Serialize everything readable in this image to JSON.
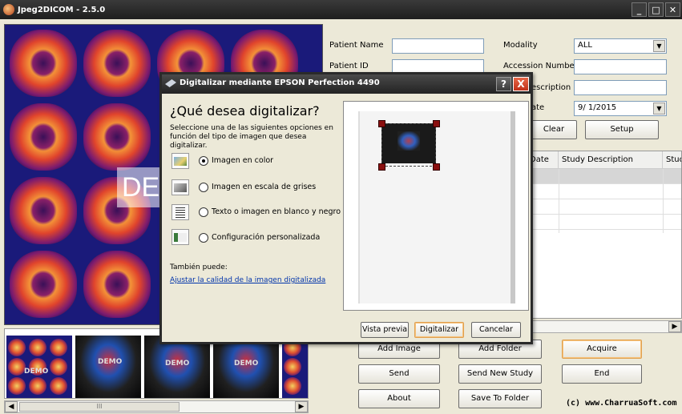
{
  "window": {
    "title": "Jpeg2DICOM - 2.5.0"
  },
  "thumbnails": {
    "overlay_text": "DEM",
    "strip_demo_label": "DEMO"
  },
  "form": {
    "patient_name_label": "Patient Name",
    "patient_id_label": "Patient ID",
    "modality_label": "Modality",
    "modality_value": "ALL",
    "accession_label": "Accession Number",
    "description_label": "escription",
    "date_label": "ate",
    "date_value": "9/ 1/2015"
  },
  "buttons": {
    "clear": "Clear",
    "setup": "Setup",
    "add_image": "Add Image",
    "add_folder": "Add Folder",
    "acquire": "Acquire",
    "send": "Send",
    "send_new_study": "Send New Study",
    "end": "End",
    "about": "About",
    "save_to_folder": "Save To Folder"
  },
  "grid": {
    "columns": [
      "Date",
      "Study Description",
      "Stud"
    ]
  },
  "copyright": "(c) www.CharruaSoft.com",
  "dialog": {
    "title": "Digitalizar mediante EPSON Perfection 4490",
    "heading": "¿Qué desea digitalizar?",
    "description": "Seleccione una de las siguientes opciones en función del tipo de imagen que desea digitalizar.",
    "options": [
      {
        "label": "Imagen en color",
        "checked": true,
        "icon": "color-photo-icon"
      },
      {
        "label": "Imagen en escala de grises",
        "checked": false,
        "icon": "grayscale-photo-icon"
      },
      {
        "label": "Texto o imagen en blanco y negro",
        "checked": false,
        "icon": "text-document-icon"
      },
      {
        "label": "Configuración personalizada",
        "checked": false,
        "icon": "custom-settings-icon"
      }
    ],
    "also_label": "También puede:",
    "link": "Ajustar la calidad de la imagen digitalizada",
    "btn_preview": "Vista previa",
    "btn_scan": "Digitalizar",
    "btn_cancel": "Cancelar",
    "help": "?",
    "close": "X"
  }
}
